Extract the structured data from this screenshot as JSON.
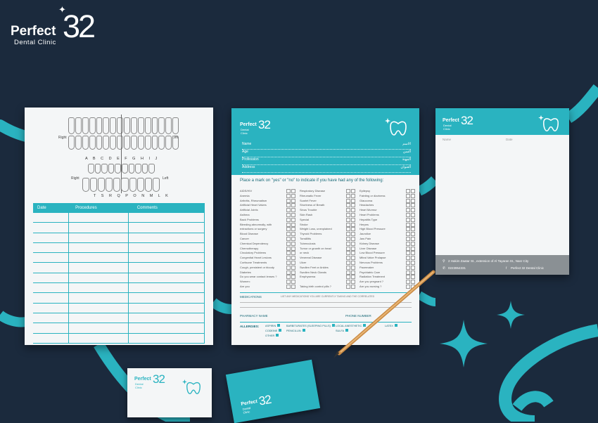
{
  "brand": {
    "name": "Perfect",
    "number": "32",
    "subtitle": "Dental Clinic",
    "accent_color": "#2ab3c0",
    "background_color": "#1b2a3d"
  },
  "chart_sheet": {
    "label_right_top": "Right",
    "label_left_top": "Left",
    "label_right_bottom": "Right",
    "label_left_bottom": "Left",
    "letters_top": "A B C D E F G H I J",
    "letters_bottom": "T S R Q P O N M L K",
    "columns": [
      "Date",
      "Procedures",
      "Comments"
    ]
  },
  "form_sheet": {
    "fields": [
      {
        "label": "Name",
        "label_ar": "الاسم"
      },
      {
        "label": "Age",
        "label_ar": "السن"
      },
      {
        "label": "Profession",
        "label_ar": "المهنة"
      },
      {
        "label": "Address",
        "label_ar": "العنوان"
      }
    ],
    "question_title": "Place a mark on \"yes\" or \"no\" to indicate if you have had any of the following:",
    "col1": [
      "AIDS/HIV",
      "Anemia",
      "Arthritis, Rheumatism",
      "Artificial Heart Valves",
      "Artificial Joints",
      "Asthma",
      "Back Problems",
      "Bleeding abnormally, with",
      "extractions or surgery",
      "Blood Disease",
      "Cancer",
      "Chemical Dependency",
      "Chemotherapy",
      "Circulatory Problems",
      "Congenital Heart Lesions",
      "Cortisone Treatments",
      "Cough, persistent or bloody",
      "Diabetes",
      "Do you wear contact lenses ?",
      "Women:",
      "Are you"
    ],
    "col2": [
      "Respiratory Disease",
      "Rheumatic Fever",
      "Scarlet Fever",
      "Shortness of Breath",
      "Sinus Trouble",
      "Skin Rash",
      "Special",
      "Stroke",
      "Weight Loss, unexplained",
      "Thyroid Problems",
      "Tonsillitis",
      "Tuberculosis",
      "Tumor or growth on head",
      "or neck",
      "Venereal Disease",
      "Ulcer",
      "Swollen Feet or Ankles",
      "Swollen Neck Glands",
      "Emphysema",
      "",
      "Taking birth control pills ?"
    ],
    "col3": [
      "Epilepsy",
      "Fainting or dizziness",
      "Glaucoma",
      "Headaches",
      "Heart Murmur",
      "Heart Problems",
      "Hepatitis Type",
      "Herpes",
      "High Blood Pressure",
      "Jaundice",
      "Jaw Pain",
      "Kidney Disease",
      "Liver Disease",
      "Low Blood Pressure",
      "Mitral Valve Prolapse",
      "Nervous Problems",
      "Pacemaker",
      "Psychiatric Care",
      "Radiation Treatment",
      "Are you pregnant ?",
      "Are you nursing ?"
    ],
    "medications_label": "MEDICATIONS",
    "medications_hint": "LIST ANY MEDICATIONS YOU ARE CURRENTLY TAKING AND THE CORRELATED",
    "pharmacy_label": "PHARMACY NAME",
    "phone_label": "PHONE NUMBER",
    "allergies_label": "ALLERGIES:",
    "allergies": [
      "ASPIRIN",
      "BARBITURATES (SLEEPING PILLS)",
      "LOCAL ANESTHETIC",
      "LATEX",
      "CODEINE",
      "PENICILLIN",
      "SULFA",
      "OTHER"
    ]
  },
  "letterhead": {
    "name_label": "Name",
    "date_label": "Date",
    "address": "2 Hakim Zaatar St., extension of Al Tayaran St., Nasr City",
    "phone": "0223954331",
    "facebook": "Perfect 32 Dental Clinic"
  }
}
